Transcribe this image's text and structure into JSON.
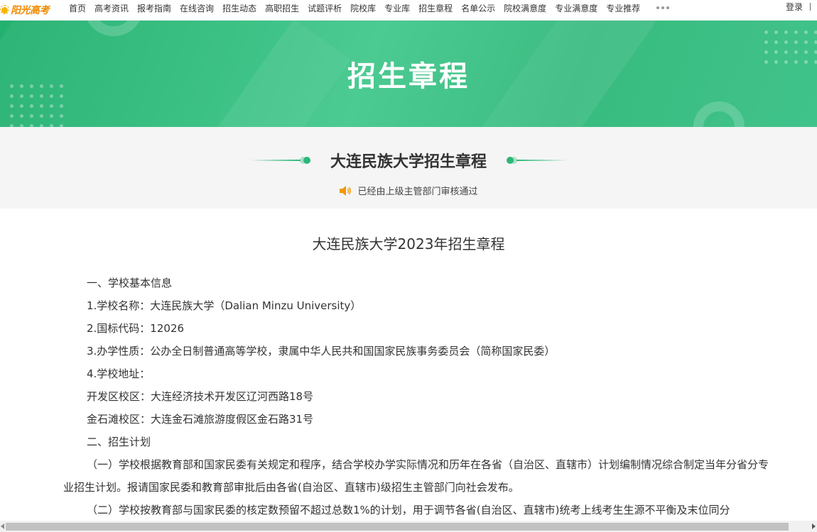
{
  "logo": {
    "text": "阳光高考"
  },
  "nav": {
    "items": [
      "首页",
      "高考资讯",
      "报考指南",
      "在线咨询",
      "招生动态",
      "高职招生",
      "试题评析",
      "院校库",
      "专业库",
      "招生章程",
      "名单公示",
      "院校满意度",
      "专业满意度",
      "专业推荐"
    ],
    "login": "登录"
  },
  "banner": {
    "title": "招生章程"
  },
  "header": {
    "subtitle": "大连民族大学招生章程",
    "verified_text": "已经由上级主管部门审核通过"
  },
  "document": {
    "title": "大连民族大学2023年招生章程",
    "lines": [
      "一、学校基本信息",
      "1.学校名称：大连民族大学（Dalian Minzu University）",
      "2.国标代码：12026",
      "3.办学性质：公办全日制普通高等学校，隶属中华人民共和国国家民族事务委员会（简称国家民委）",
      "4.学校地址：",
      "开发区校区：大连经济技术开发区辽河西路18号",
      "金石滩校区：大连金石滩旅游度假区金石路31号",
      "二、招生计划"
    ],
    "paragraph1": "（一）学校根据教育部和国家民委有关规定和程序，结合学校办学实际情况和历年在各省（自治区、直辖市）计划编制情况综合制定当年分省分专业招生计划。报请国家民委和教育部审批后由各省(自治区、直辖市)级招生主管部门向社会发布。",
    "paragraph2": "（二）学校按教育部与国家民委的核定数预留不超过总数1%的计划，用于调节各省(自治区、直辖市)统考上线考生生源不平衡及末位同分"
  },
  "colors": {
    "accent": "#2bb777",
    "banner": "#3cc689",
    "logo": "#f08a00"
  }
}
